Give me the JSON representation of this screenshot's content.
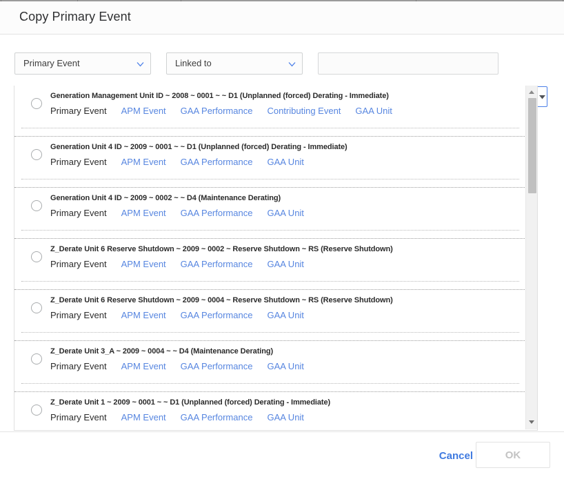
{
  "dialog": {
    "title": "Copy Primary Event"
  },
  "filter_bar": {
    "entity_select": {
      "value": "Primary Event",
      "icon": "chevron-down-icon"
    },
    "relation_select": {
      "value": "Linked to",
      "icon": "chevron-down-icon"
    },
    "search_field": {
      "value": "",
      "placeholder": ""
    },
    "search_button": {
      "icon": "search-icon"
    },
    "search_options_button": {
      "icon": "caret-down-icon"
    }
  },
  "results": {
    "rows": [
      {
        "title": "Generation Management Unit ID ~ 2008 ~ 0001 ~ ~ D1 (Unplanned (forced) Derating - Immediate)",
        "links": [
          "Primary Event",
          "APM Event",
          "GAA Performance",
          "Contributing Event",
          "GAA Unit"
        ],
        "active_link": "Primary Event",
        "selected": false
      },
      {
        "title": "Generation Unit 4 ID ~ 2009 ~ 0001 ~ ~ D1 (Unplanned (forced) Derating - Immediate)",
        "links": [
          "Primary Event",
          "APM Event",
          "GAA Performance",
          "GAA Unit"
        ],
        "active_link": "Primary Event",
        "selected": false
      },
      {
        "title": "Generation Unit 4 ID ~ 2009 ~ 0002 ~ ~ D4 (Maintenance Derating)",
        "links": [
          "Primary Event",
          "APM Event",
          "GAA Performance",
          "GAA Unit"
        ],
        "active_link": "Primary Event",
        "selected": false
      },
      {
        "title": "Z_Derate Unit 6 Reserve Shutdown ~ 2009 ~ 0002 ~ Reserve Shutdown ~ RS (Reserve Shutdown)",
        "links": [
          "Primary Event",
          "APM Event",
          "GAA Performance",
          "GAA Unit"
        ],
        "active_link": "Primary Event",
        "selected": false
      },
      {
        "title": "Z_Derate Unit 6 Reserve Shutdown ~ 2009 ~ 0004 ~ Reserve Shutdown ~ RS (Reserve Shutdown)",
        "links": [
          "Primary Event",
          "APM Event",
          "GAA Performance",
          "GAA Unit"
        ],
        "active_link": "Primary Event",
        "selected": false
      },
      {
        "title": "Z_Derate Unit 3_A ~ 2009 ~ 0004 ~ ~ D4 (Maintenance Derating)",
        "links": [
          "Primary Event",
          "APM Event",
          "GAA Performance",
          "GAA Unit"
        ],
        "active_link": "Primary Event",
        "selected": false
      },
      {
        "title": "Z_Derate Unit 1 ~ 2009 ~ 0001 ~ ~ D1 (Unplanned (forced) Derating - Immediate)",
        "links": [
          "Primary Event",
          "APM Event",
          "GAA Performance",
          "GAA Unit"
        ],
        "active_link": "Primary Event",
        "selected": false
      }
    ],
    "scrollbar": {
      "up_icon": "triangle-up-icon",
      "down_icon": "triangle-down-icon"
    }
  },
  "footer": {
    "cancel_label": "Cancel",
    "ok_label": "OK",
    "ok_disabled": true
  },
  "colors": {
    "link": "#5786e0",
    "accent": "#3f7ae0",
    "border": "#d0d2d3",
    "disabled_text": "#c3c3c3"
  }
}
